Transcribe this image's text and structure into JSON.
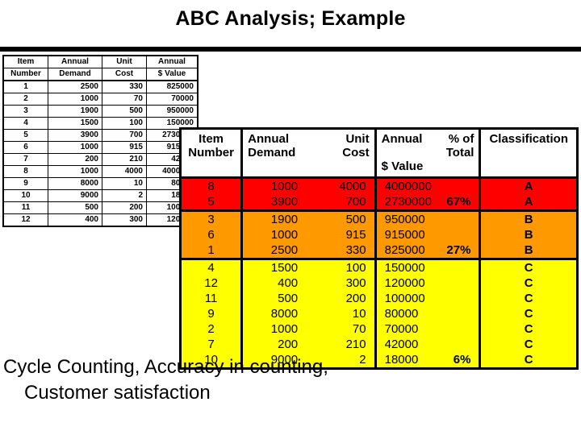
{
  "slide": {
    "title": "ABC Analysis; Example",
    "caption_line_1": "Cycle Counting, Accuracy in counting,",
    "caption_line_2": "Customer satisfaction"
  },
  "colors": {
    "class_a": "#FF0000",
    "class_b": "#FF9900",
    "class_c": "#FFFF00",
    "rule": "#000000",
    "text": "#000000",
    "background": "#FFFFFF"
  },
  "raw_table": {
    "headers_line1": [
      "Item",
      "Annual",
      "Unit",
      "Annual"
    ],
    "headers_line2": [
      "Number",
      "Demand",
      "Cost",
      "$ Value"
    ],
    "rows": [
      {
        "item": "1",
        "demand": "2500",
        "cost": "330",
        "value": "825000"
      },
      {
        "item": "2",
        "demand": "1000",
        "cost": "70",
        "value": "70000"
      },
      {
        "item": "3",
        "demand": "1900",
        "cost": "500",
        "value": "950000"
      },
      {
        "item": "4",
        "demand": "1500",
        "cost": "100",
        "value": "150000"
      },
      {
        "item": "5",
        "demand": "3900",
        "cost": "700",
        "value": "2730000"
      },
      {
        "item": "6",
        "demand": "1000",
        "cost": "915",
        "value": "915000"
      },
      {
        "item": "7",
        "demand": "200",
        "cost": "210",
        "value": "42000"
      },
      {
        "item": "8",
        "demand": "1000",
        "cost": "4000",
        "value": "4000000"
      },
      {
        "item": "9",
        "demand": "8000",
        "cost": "10",
        "value": "80000"
      },
      {
        "item": "10",
        "demand": "9000",
        "cost": "2",
        "value": "18000"
      },
      {
        "item": "11",
        "demand": "500",
        "cost": "200",
        "value": "100000"
      },
      {
        "item": "12",
        "demand": "400",
        "cost": "300",
        "value": "120000"
      }
    ]
  },
  "abc_table": {
    "headers": {
      "item_l1": "Item",
      "item_l2": "Number",
      "demand_l1": "Annual",
      "demand_l2": "Demand",
      "cost_l1": "Unit",
      "cost_l2": "Cost",
      "value_l1": "Annual",
      "value_l2": "$ Value",
      "pct": "% of Total",
      "classification": "Classification"
    },
    "rows": [
      {
        "item": "8",
        "demand": "1000",
        "cost": "4000",
        "value": "4000000",
        "pct": "",
        "cls": "A",
        "band": "a",
        "band_end": false
      },
      {
        "item": "5",
        "demand": "3900",
        "cost": "700",
        "value": "2730000",
        "pct": "67%",
        "cls": "A",
        "band": "a",
        "band_end": true
      },
      {
        "item": "3",
        "demand": "1900",
        "cost": "500",
        "value": "950000",
        "pct": "",
        "cls": "B",
        "band": "b",
        "band_end": false
      },
      {
        "item": "6",
        "demand": "1000",
        "cost": "915",
        "value": "915000",
        "pct": "",
        "cls": "B",
        "band": "b",
        "band_end": false
      },
      {
        "item": "1",
        "demand": "2500",
        "cost": "330",
        "value": "825000",
        "pct": "27%",
        "cls": "B",
        "band": "b",
        "band_end": true
      },
      {
        "item": "4",
        "demand": "1500",
        "cost": "100",
        "value": "150000",
        "pct": "",
        "cls": "C",
        "band": "c",
        "band_end": false
      },
      {
        "item": "12",
        "demand": "400",
        "cost": "300",
        "value": "120000",
        "pct": "",
        "cls": "C",
        "band": "c",
        "band_end": false
      },
      {
        "item": "11",
        "demand": "500",
        "cost": "200",
        "value": "100000",
        "pct": "",
        "cls": "C",
        "band": "c",
        "band_end": false
      },
      {
        "item": "9",
        "demand": "8000",
        "cost": "10",
        "value": "80000",
        "pct": "",
        "cls": "C",
        "band": "c",
        "band_end": false
      },
      {
        "item": "2",
        "demand": "1000",
        "cost": "70",
        "value": "70000",
        "pct": "",
        "cls": "C",
        "band": "c",
        "band_end": false
      },
      {
        "item": "7",
        "demand": "200",
        "cost": "210",
        "value": "42000",
        "pct": "",
        "cls": "C",
        "band": "c",
        "band_end": false
      },
      {
        "item": "10",
        "demand": "9000",
        "cost": "2",
        "value": "18000",
        "pct": "6%",
        "cls": "C",
        "band": "c",
        "band_end": true
      }
    ]
  }
}
